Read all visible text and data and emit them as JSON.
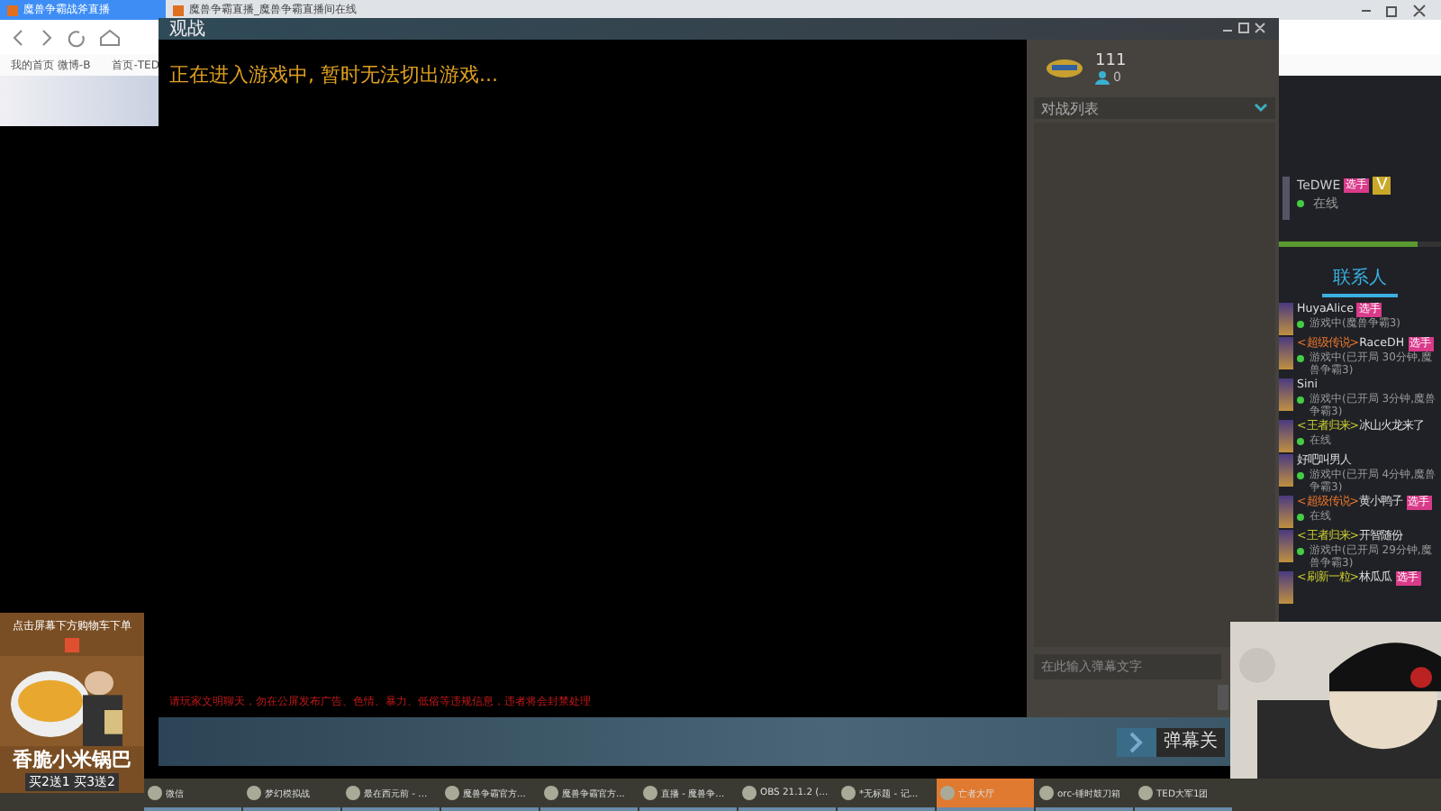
{
  "browser": {
    "tabs": [
      {
        "label": "魔兽争霸战斧直播",
        "selected": true
      },
      {
        "label": "魔兽争霸直播_魔兽争霸直播间在线",
        "selected": false
      }
    ],
    "bookmarks": [
      "我的首页 微博-B",
      "首页-TED"
    ]
  },
  "dialog": {
    "title": "观战",
    "status": "正在进入游戏中, 暂时无法切出游戏...",
    "notice": "请玩家文明聊天，勿在公屏发布广告、色情、暴力、低俗等违规信息，违者将会封禁处理",
    "player": {
      "name": "111",
      "count": "0"
    },
    "list_header": "对战列表",
    "chat_placeholder": "在此输入弹幕文字",
    "danmaku_button": "弹幕关"
  },
  "streamer": {
    "name": "TeDWE",
    "badge": "选手",
    "vip": "V",
    "status": "在线",
    "level": 0.85
  },
  "contact_tabs": [
    {
      "label": "联系人",
      "selected": true
    }
  ],
  "contacts": [
    {
      "name": "HuyaAlice",
      "badge": "选手",
      "status": "游戏中(魔兽争霸3)"
    },
    {
      "prefix": "<超级传说>",
      "color": "#e8742a",
      "name": "RaceDH",
      "badge": "选手",
      "status": "游戏中(已开局 30分钟,魔兽争霸3)"
    },
    {
      "name": "Sini",
      "status": "游戏中(已开局 3分钟,魔兽争霸3)"
    },
    {
      "prefix": "<王者归来>",
      "color": "#c8c830",
      "name": "冰山火龙来了",
      "status": "在线"
    },
    {
      "name": "好吧叫男人",
      "status": "游戏中(已开局 4分钟,魔兽争霸3)"
    },
    {
      "prefix": "<超级传说>",
      "color": "#e8742a",
      "name": "黄小鸭子",
      "badge": "选手",
      "status": "在线"
    },
    {
      "prefix": "<王者归来>",
      "color": "#c8c830",
      "name": "开智随份",
      "status": "游戏中(已开局 29分钟,魔兽争霸3)"
    },
    {
      "prefix": "<刷新一粒>",
      "color": "#c8c830",
      "name": "林瓜瓜",
      "badge": "选手"
    }
  ],
  "promo": {
    "top": "点击屏幕下方购物车下单",
    "title": "香脆小米锅巴",
    "deal": "买2送1 买3送2"
  },
  "taskbar": [
    {
      "label": "微信",
      "selected": false
    },
    {
      "label": "梦幻模拟战",
      "selected": false
    },
    {
      "label": "最在西元前 - ...",
      "selected": false
    },
    {
      "label": "魔兽争霸官方...",
      "selected": false
    },
    {
      "label": "魔兽争霸官方...",
      "selected": false
    },
    {
      "label": "直播 - 魔兽争...",
      "selected": false
    },
    {
      "label": "OBS 21.1.2 (...",
      "selected": false
    },
    {
      "label": "*无标题 - 记...",
      "selected": false
    },
    {
      "label": "亡者大厅",
      "selected": true
    },
    {
      "label": "orc-锤时鼓刀箱",
      "selected": false
    },
    {
      "label": "TED大军1团",
      "selected": false
    }
  ]
}
